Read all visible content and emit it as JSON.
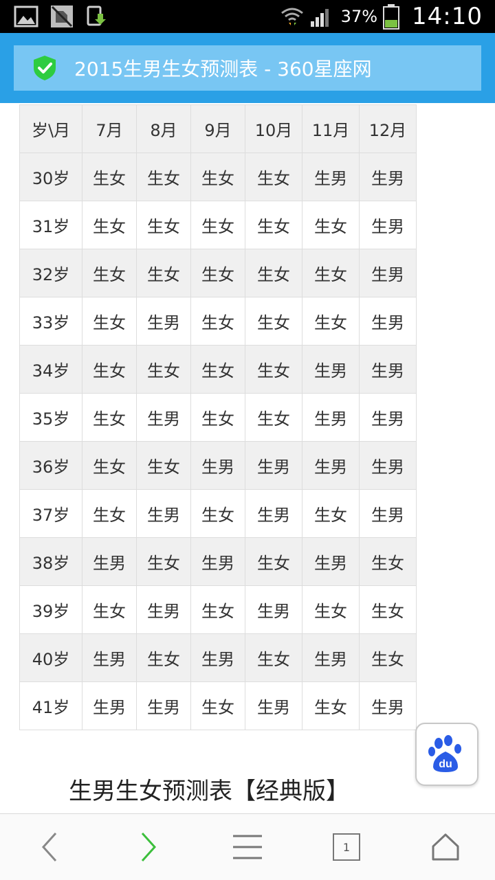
{
  "status_bar": {
    "battery_percent": "37%",
    "time": "14:10"
  },
  "header": {
    "title": "2015生男生女预测表 - 360星座网"
  },
  "table": {
    "columns": [
      "岁\\月",
      "7月",
      "8月",
      "9月",
      "10月",
      "11月",
      "12月"
    ],
    "rows": [
      [
        "30岁",
        "生女",
        "生女",
        "生女",
        "生女",
        "生男",
        "生男"
      ],
      [
        "31岁",
        "生女",
        "生女",
        "生女",
        "生女",
        "生女",
        "生男"
      ],
      [
        "32岁",
        "生女",
        "生女",
        "生女",
        "生女",
        "生女",
        "生男"
      ],
      [
        "33岁",
        "生女",
        "生男",
        "生女",
        "生女",
        "生女",
        "生男"
      ],
      [
        "34岁",
        "生女",
        "生女",
        "生女",
        "生女",
        "生男",
        "生男"
      ],
      [
        "35岁",
        "生女",
        "生男",
        "生女",
        "生女",
        "生男",
        "生男"
      ],
      [
        "36岁",
        "生女",
        "生女",
        "生男",
        "生男",
        "生男",
        "生男"
      ],
      [
        "37岁",
        "生女",
        "生男",
        "生女",
        "生男",
        "生女",
        "生男"
      ],
      [
        "38岁",
        "生男",
        "生女",
        "生男",
        "生女",
        "生男",
        "生女"
      ],
      [
        "39岁",
        "生女",
        "生男",
        "生女",
        "生男",
        "生女",
        "生女"
      ],
      [
        "40岁",
        "生男",
        "生女",
        "生男",
        "生女",
        "生男",
        "生女"
      ],
      [
        "41岁",
        "生男",
        "生男",
        "生女",
        "生男",
        "生女",
        "生男"
      ]
    ]
  },
  "section": {
    "heading": "生男生女预测表【经典版】"
  },
  "baidu_button": {
    "icon": "baidu-paw-icon",
    "label": "du"
  },
  "bottom_nav": {
    "tab_count": "1",
    "items": [
      "back-icon",
      "forward-icon",
      "menu-icon",
      "tabs-icon",
      "home-icon"
    ]
  },
  "colors": {
    "title_bar": "#2aa0e6",
    "title_inner": "#78c6f3",
    "shield": "#2ecc40",
    "forward_arrow": "#3cbf3c",
    "baidu_blue": "#2a5ce6"
  }
}
